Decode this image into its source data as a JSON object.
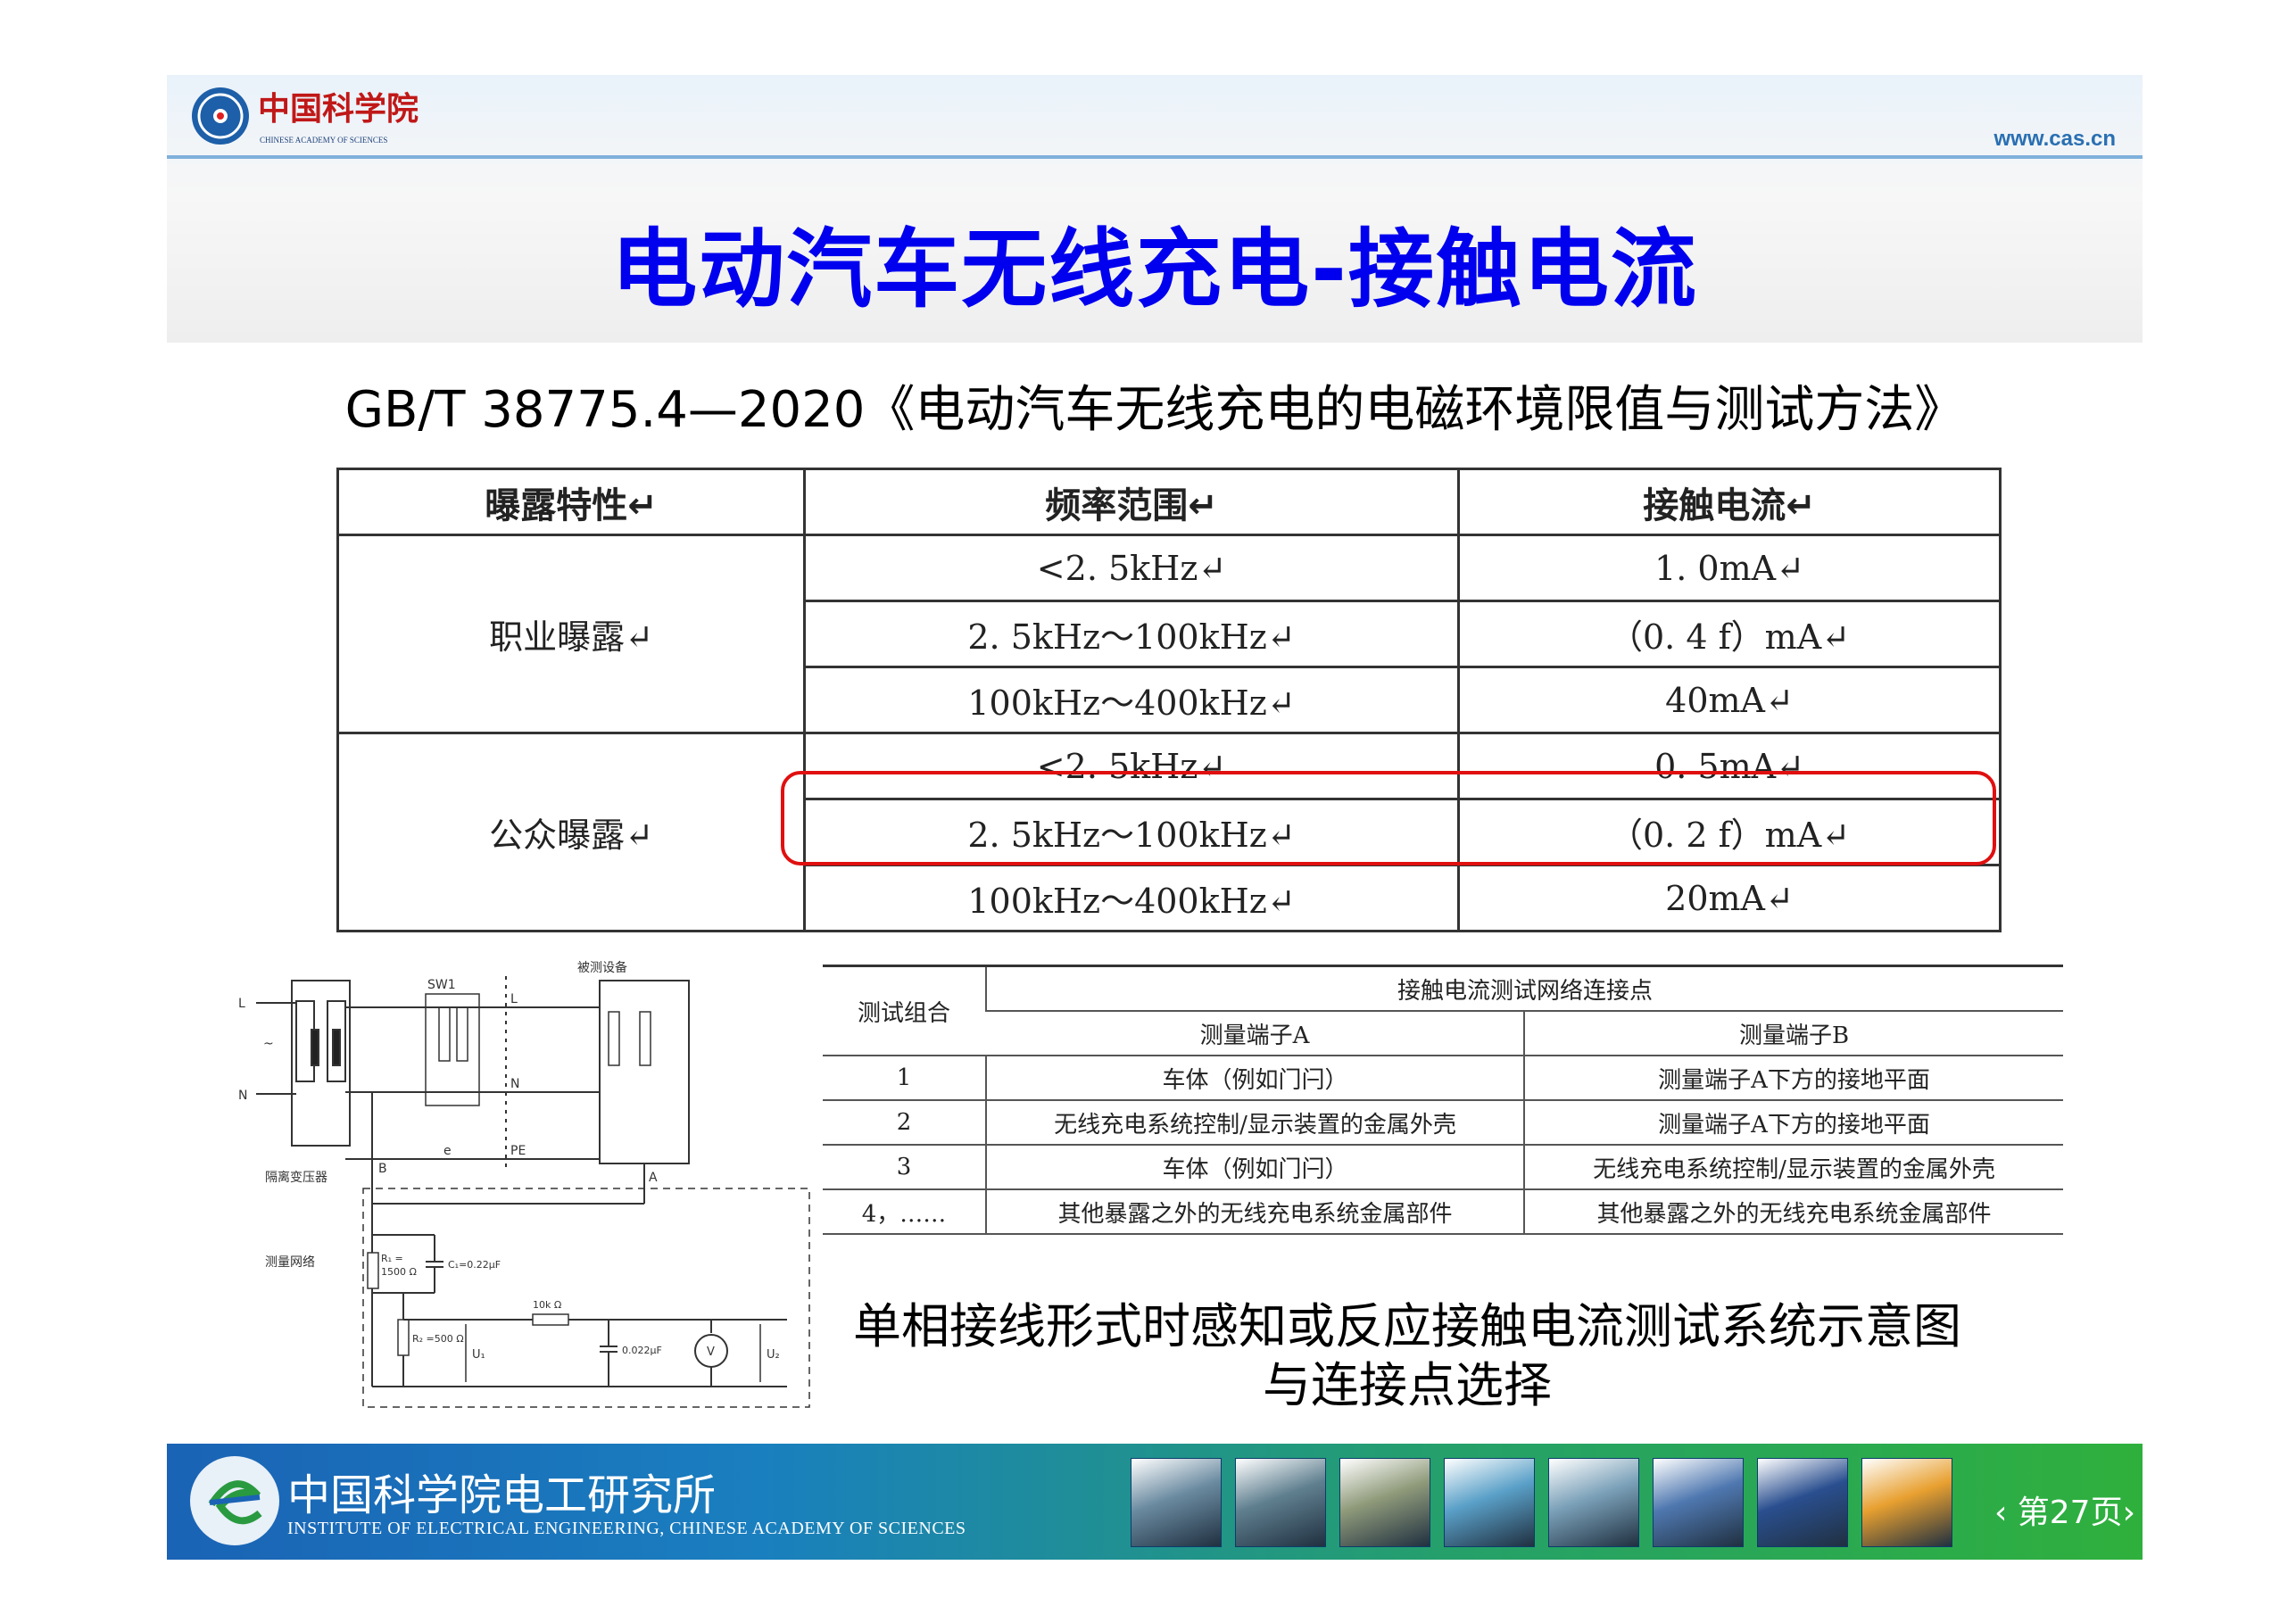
{
  "header": {
    "logo_cn": "中国科学院",
    "logo_en": "CHINESE ACADEMY OF SCIENCES",
    "url": "www.cas.cn"
  },
  "title": "电动汽车无线充电-接触电流",
  "subtitle": "GB/T 38775.4—2020《电动汽车无线充电的电磁环境限值与测试方法》",
  "limit_table": {
    "headers": [
      "曝露特性↵",
      "频率范围↵",
      "接触电流↵"
    ],
    "groups": [
      {
        "label": "职业曝露↵",
        "rows": [
          {
            "freq": "<2. 5kHz↵",
            "current": "1. 0mA↵"
          },
          {
            "freq": "2. 5kHz～100kHz↵",
            "current": "（0. 4  f）mA↵"
          },
          {
            "freq": "100kHz～400kHz↵",
            "current": "40mA↵"
          }
        ]
      },
      {
        "label": "公众曝露↵",
        "rows": [
          {
            "freq": "<2. 5kHz↵",
            "current": "0. 5mA↵"
          },
          {
            "freq": "2. 5kHz～100kHz↵",
            "current": "（0. 2  f）mA↵"
          },
          {
            "freq": "100kHz～400kHz↵",
            "current": "20mA↵"
          }
        ]
      }
    ]
  },
  "circuit": {
    "device_label": "被测设备",
    "switch_label": "SW1",
    "line_L": "L",
    "line_N": "N",
    "line_PE": "PE",
    "tilde": "~",
    "terminal_A": "A",
    "terminal_B": "B",
    "switch_e": "e",
    "transformer_label": "隔离变压器",
    "network_label": "测量网络",
    "r1_label": "R₁ =",
    "r1_value": "1500 Ω",
    "c1_label": "C₁=0.22μF",
    "r_series": "10k Ω",
    "r2_label": "R₂ =500 Ω",
    "u1_label": "U₁",
    "c2_label": "0.022μF",
    "meter_label": "V",
    "u2_label": "U₂"
  },
  "conn_table": {
    "col_group": "测试组合",
    "span_header": "接触电流测试网络连接点",
    "col_a": "测量端子A",
    "col_b": "测量端子B",
    "rows": [
      {
        "id": "1",
        "a": "车体（例如门闩）",
        "b": "测量端子A下方的接地平面"
      },
      {
        "id": "2",
        "a": "无线充电系统控制/显示装置的金属外壳",
        "b": "测量端子A下方的接地平面"
      },
      {
        "id": "3",
        "a": "车体（例如门闩）",
        "b": "无线充电系统控制/显示装置的金属外壳"
      },
      {
        "id": "4，……",
        "a": "其他暴露之外的无线充电系统金属部件",
        "b": "其他暴露之外的无线充电系统金属部件"
      }
    ]
  },
  "caption": {
    "line1": "单相接线形式时感知或反应接触电流测试系统示意图",
    "line2": "与连接点选择"
  },
  "footer": {
    "org_cn": "中国科学院电工研究所",
    "org_en": "INSTITUTE OF ELECTRICAL ENGINEERING, CHINESE ACADEMY OF SCIENCES",
    "page": "第27页",
    "thumbs": [
      "#6a8aa0",
      "#5f7f8f",
      "#8f9a7a",
      "#5aa0c8",
      "#7aa0b8",
      "#4f78b0",
      "#2a4f8f",
      "#e8a030"
    ]
  },
  "colors": {
    "title": "#0000ee",
    "highlight_box": "#e01010"
  }
}
